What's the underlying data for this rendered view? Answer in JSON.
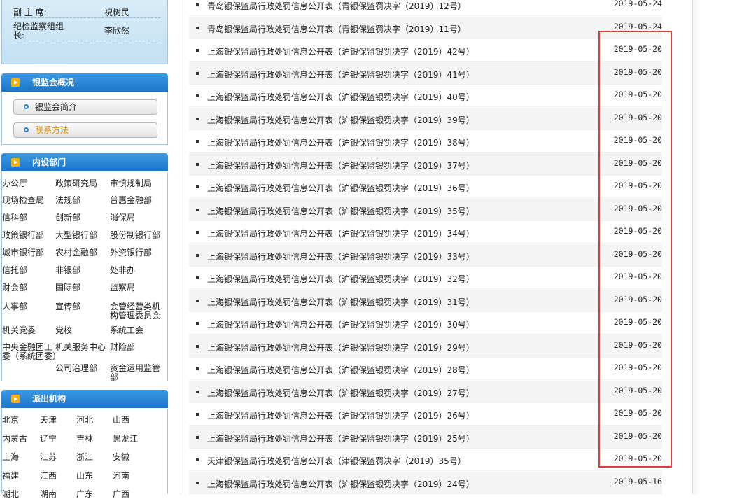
{
  "leaders": [
    {
      "role": "副 主 席:",
      "name": "祝树民"
    },
    {
      "role": "纪检监察组组长:",
      "name": "李欣然"
    }
  ],
  "overview": {
    "title": "银监会概况",
    "items": [
      {
        "label": "银监会简介",
        "color": "#333333"
      },
      {
        "label": "联系方法",
        "color": "#e08a00"
      }
    ]
  },
  "departments": {
    "title": "内设部门",
    "cells": [
      "办公厅",
      "政策研究局",
      "审慎规制局",
      "现场检查局",
      "法规部",
      "普惠金融部",
      "信科部",
      "创新部",
      "消保局",
      "政策银行部",
      "大型银行部",
      "股份制银行部",
      "城市银行部",
      "农村金融部",
      "外资银行部",
      "信托部",
      "非银部",
      "处非办",
      "财会部",
      "国际部",
      "监察局",
      "人事部",
      "宣传部",
      "会管经营类机构管理委员会",
      "机关党委",
      "党校",
      "系统工会",
      "中央金融团工委（系统团委）",
      "机关服务中心",
      "财险部",
      "",
      "公司治理部",
      "资金运用监管部"
    ]
  },
  "branches": {
    "title": "派出机构",
    "cells": [
      "北京",
      "天津",
      "河北",
      "山西",
      "内蒙古",
      "辽宁",
      "吉林",
      "黑龙江",
      "上海",
      "江苏",
      "浙江",
      "安徽",
      "福建",
      "江西",
      "山东",
      "河南",
      "湖北",
      "湖南",
      "广东",
      "广西"
    ]
  },
  "list": [
    {
      "title": "青岛银保监局行政处罚信息公开表（青银保监罚决字（2019）12号）",
      "date": "2019-05-24"
    },
    {
      "title": "青岛银保监局行政处罚信息公开表（青银保监罚决字（2019）11号）",
      "date": "2019-05-24"
    },
    {
      "title": "上海银保监局行政处罚信息公开表（沪银保监银罚决字（2019）42号）",
      "date": "2019-05-20"
    },
    {
      "title": "上海银保监局行政处罚信息公开表（沪银保监银罚决字（2019）41号）",
      "date": "2019-05-20"
    },
    {
      "title": "上海银保监局行政处罚信息公开表（沪银保监银罚决字（2019）40号）",
      "date": "2019-05-20"
    },
    {
      "title": "上海银保监局行政处罚信息公开表（沪银保监银罚决字（2019）39号）",
      "date": "2019-05-20"
    },
    {
      "title": "上海银保监局行政处罚信息公开表（沪银保监银罚决字（2019）38号）",
      "date": "2019-05-20"
    },
    {
      "title": "上海银保监局行政处罚信息公开表（沪银保监银罚决字（2019）37号）",
      "date": "2019-05-20"
    },
    {
      "title": "上海银保监局行政处罚信息公开表（沪银保监银罚决字（2019）36号）",
      "date": "2019-05-20"
    },
    {
      "title": "上海银保监局行政处罚信息公开表（沪银保监银罚决字（2019）35号）",
      "date": "2019-05-20"
    },
    {
      "title": "上海银保监局行政处罚信息公开表（沪银保监银罚决字（2019）34号）",
      "date": "2019-05-20"
    },
    {
      "title": "上海银保监局行政处罚信息公开表（沪银保监银罚决字（2019）33号）",
      "date": "2019-05-20"
    },
    {
      "title": "上海银保监局行政处罚信息公开表（沪银保监银罚决字（2019）32号）",
      "date": "2019-05-20"
    },
    {
      "title": "上海银保监局行政处罚信息公开表（沪银保监银罚决字（2019）31号）",
      "date": "2019-05-20"
    },
    {
      "title": "上海银保监局行政处罚信息公开表（沪银保监银罚决字（2019）30号）",
      "date": "2019-05-20"
    },
    {
      "title": "上海银保监局行政处罚信息公开表（沪银保监银罚决字（2019）29号）",
      "date": "2019-05-20"
    },
    {
      "title": "上海银保监局行政处罚信息公开表（沪银保监银罚决字（2019）28号）",
      "date": "2019-05-20"
    },
    {
      "title": "上海银保监局行政处罚信息公开表（沪银保监银罚决字（2019）27号）",
      "date": "2019-05-20"
    },
    {
      "title": "上海银保监局行政处罚信息公开表（沪银保监银罚决字（2019）26号）",
      "date": "2019-05-20"
    },
    {
      "title": "上海银保监局行政处罚信息公开表（沪银保监银罚决字（2019）25号）",
      "date": "2019-05-20"
    },
    {
      "title": "天津银保监局行政处罚信息公开表（津银保监罚决字（2019）35号）",
      "date": "2019-05-20"
    },
    {
      "title": "上海银保监局行政处罚信息公开表（沪银保监银罚决字（2019）24号）",
      "date": "2019-05-16"
    }
  ],
  "colors": {
    "highlight": "#e03c3c",
    "panel_blue": "#1b74c9",
    "link_orange": "#e08a00"
  }
}
